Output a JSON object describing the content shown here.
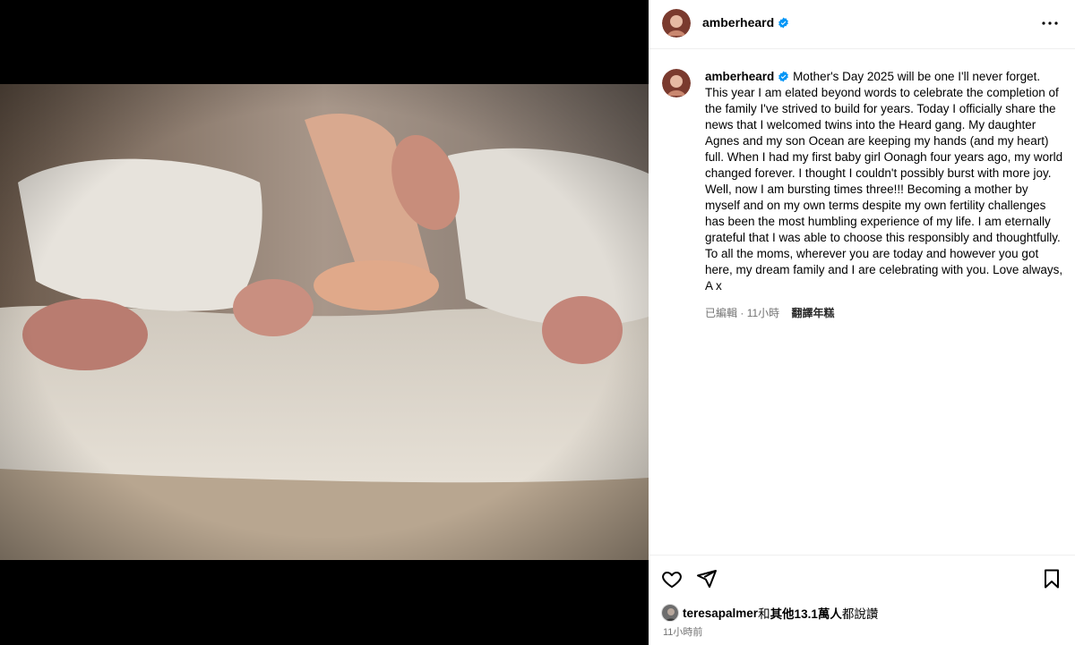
{
  "post": {
    "username": "amberheard",
    "caption": "Mother's Day 2025 will be one I'll never forget. This year I am elated beyond words to celebrate the completion of the family I've strived to build for years. Today I officially share the news that I welcomed twins into the Heard gang. My daughter Agnes and my son Ocean are keeping my hands (and my heart) full. When I had my first baby girl Oonagh four years ago, my world changed forever. I thought I couldn't possibly burst with more joy. Well, now I am bursting times three!!! Becoming a mother by myself and on my own terms despite my own fertility challenges has been the most humbling experience of my life. I am eternally grateful that I was able to choose this responsibly and thoughtfully. To all the moms, wherever you are today and however you got here, my dream family and I are celebrating with you. Love always,\nA x",
    "edited_label": "已編輯",
    "caption_time": "11小時",
    "translate_label": "翻譯年糕",
    "likes_user": "teresapalmer",
    "likes_text_and": "和",
    "likes_others": "其他13.1萬人",
    "likes_text_suffix": "都說讚",
    "post_time": "11小時前"
  },
  "colors": {
    "verified_blue": "#0095f6",
    "meta_gray": "#737373"
  },
  "icons": {
    "more": "more-horizontal-icon",
    "like": "heart-outline-icon",
    "share": "send-icon",
    "save": "bookmark-icon",
    "verified": "verified-badge-icon"
  }
}
